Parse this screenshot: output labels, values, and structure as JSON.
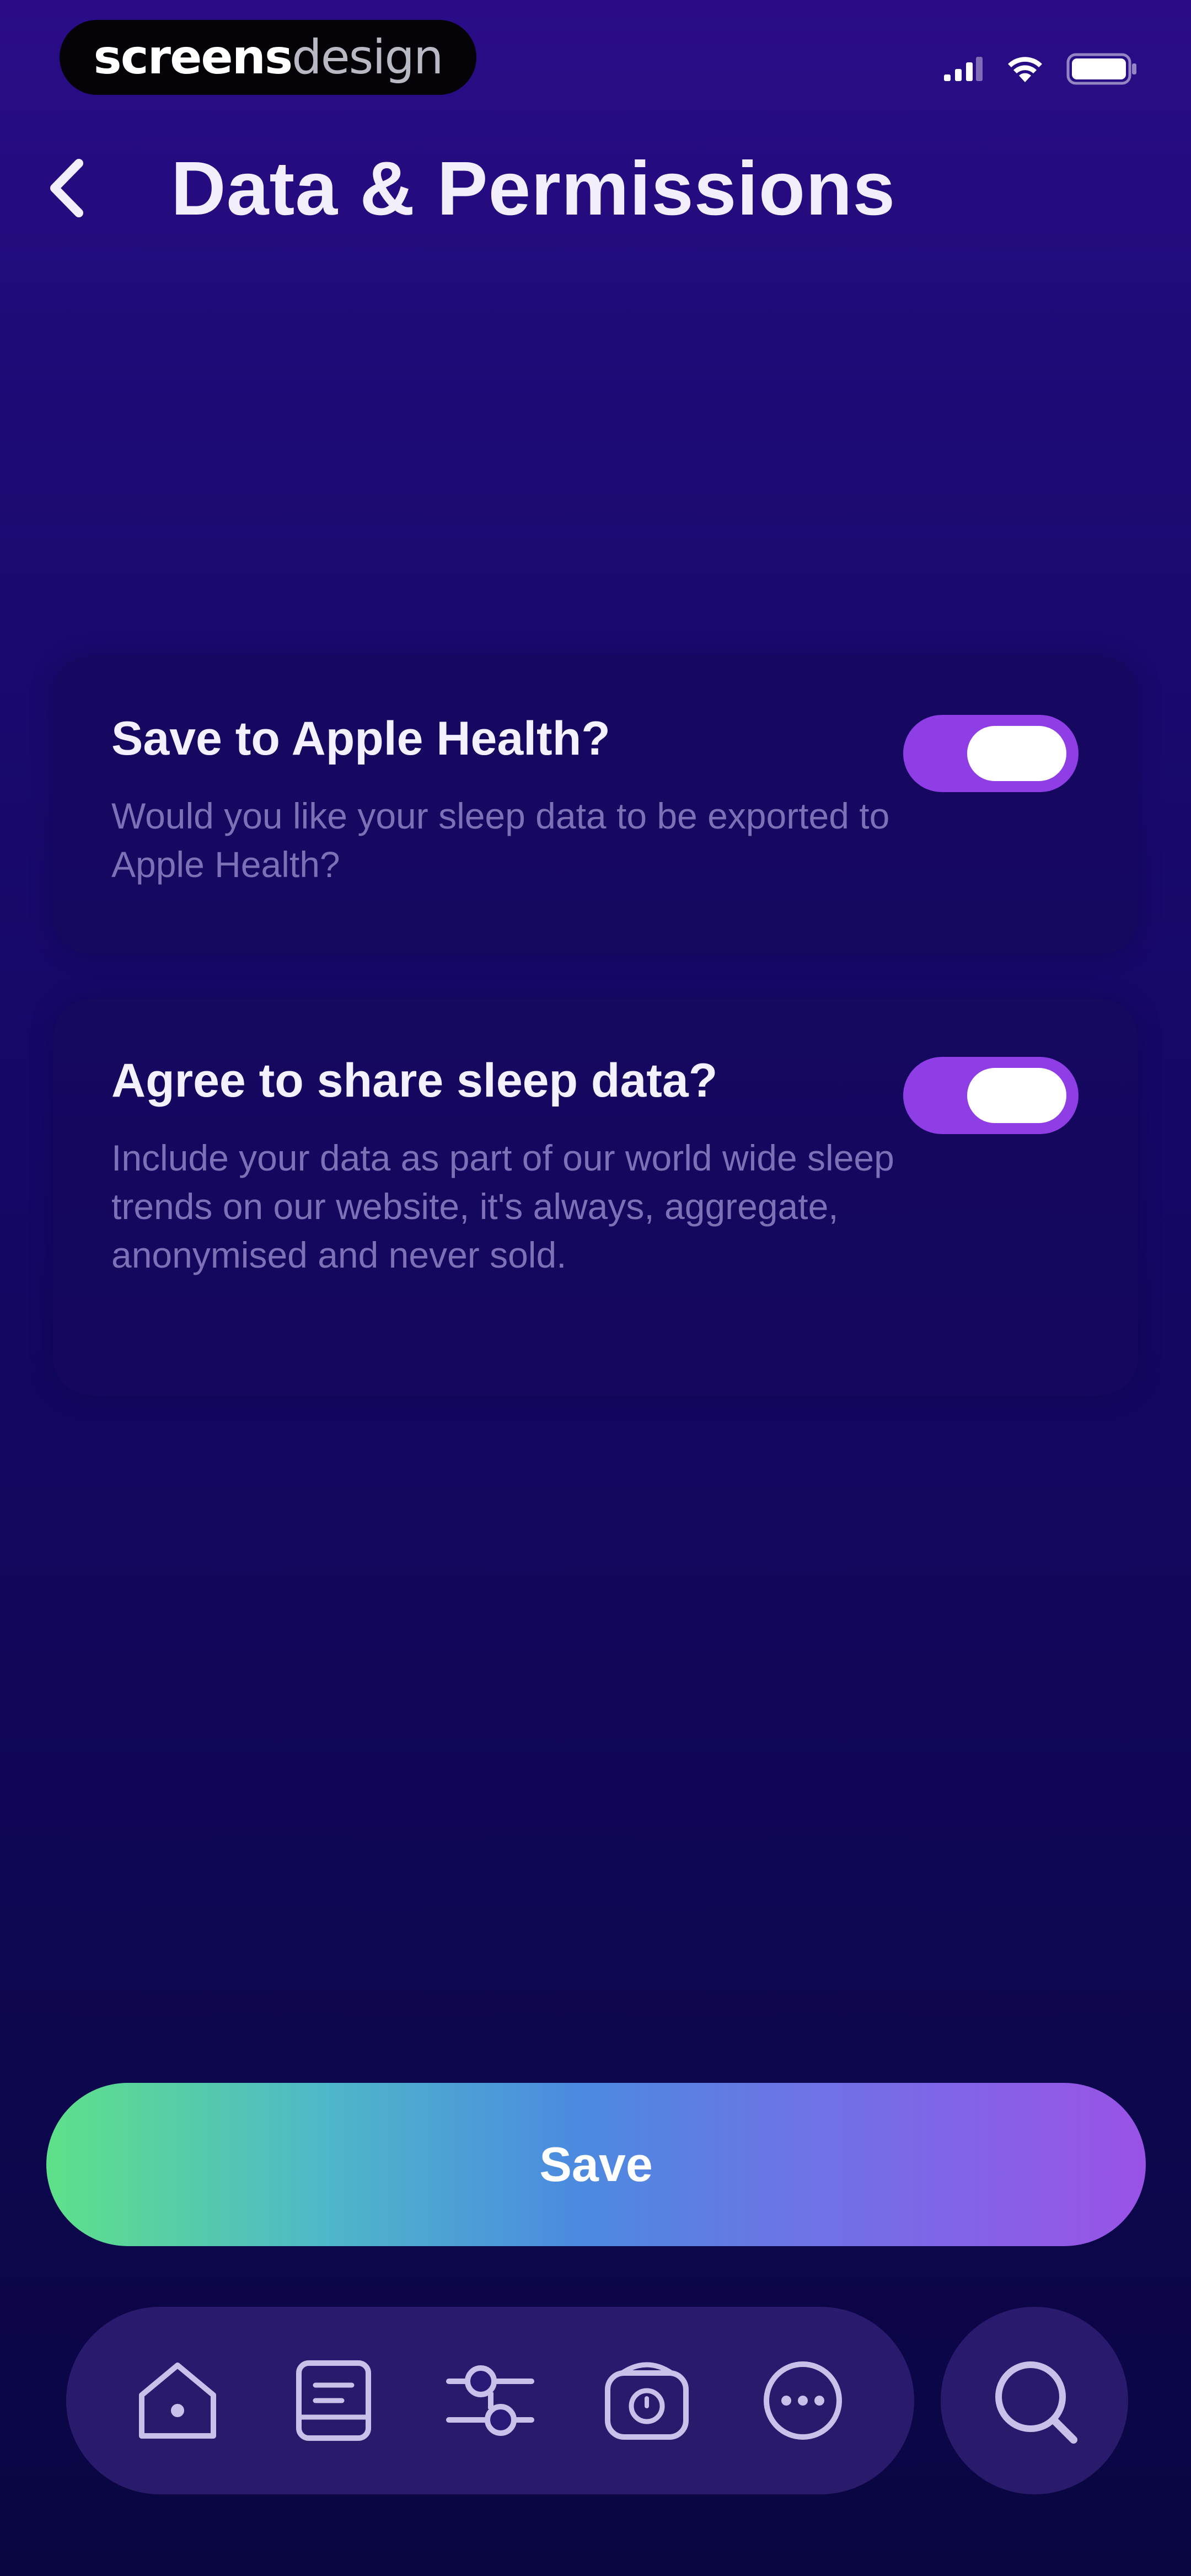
{
  "status_bar": {
    "brand_bold": "screens",
    "brand_light": "design",
    "icons": [
      "cellular-signal-icon",
      "wifi-icon",
      "battery-icon"
    ]
  },
  "header": {
    "back_icon": "chevron-left-icon",
    "title": "Data & Permissions"
  },
  "settings": [
    {
      "title": "Save to Apple Health?",
      "description": "Would you like your sleep data to be exported to Apple Health?",
      "enabled": true
    },
    {
      "title": "Agree to share sleep data?",
      "description": "Include your data as part of our world wide sleep trends on our website, it's always, aggregate, anonymised and never sold.",
      "enabled": true
    }
  ],
  "actions": {
    "save_label": "Save"
  },
  "bottom_nav": {
    "items": [
      "home-icon",
      "journal-icon",
      "sliders-icon",
      "alarm-clock-icon",
      "more-icon"
    ],
    "search_icon": "search-icon"
  },
  "colors": {
    "background_top": "#2a0c88",
    "background_bottom": "#0a0642",
    "toggle_on": "#8f3ee6",
    "save_gradient_start": "#5ee189",
    "save_gradient_end": "#9a52e6",
    "description_text": "#7e70b6"
  }
}
